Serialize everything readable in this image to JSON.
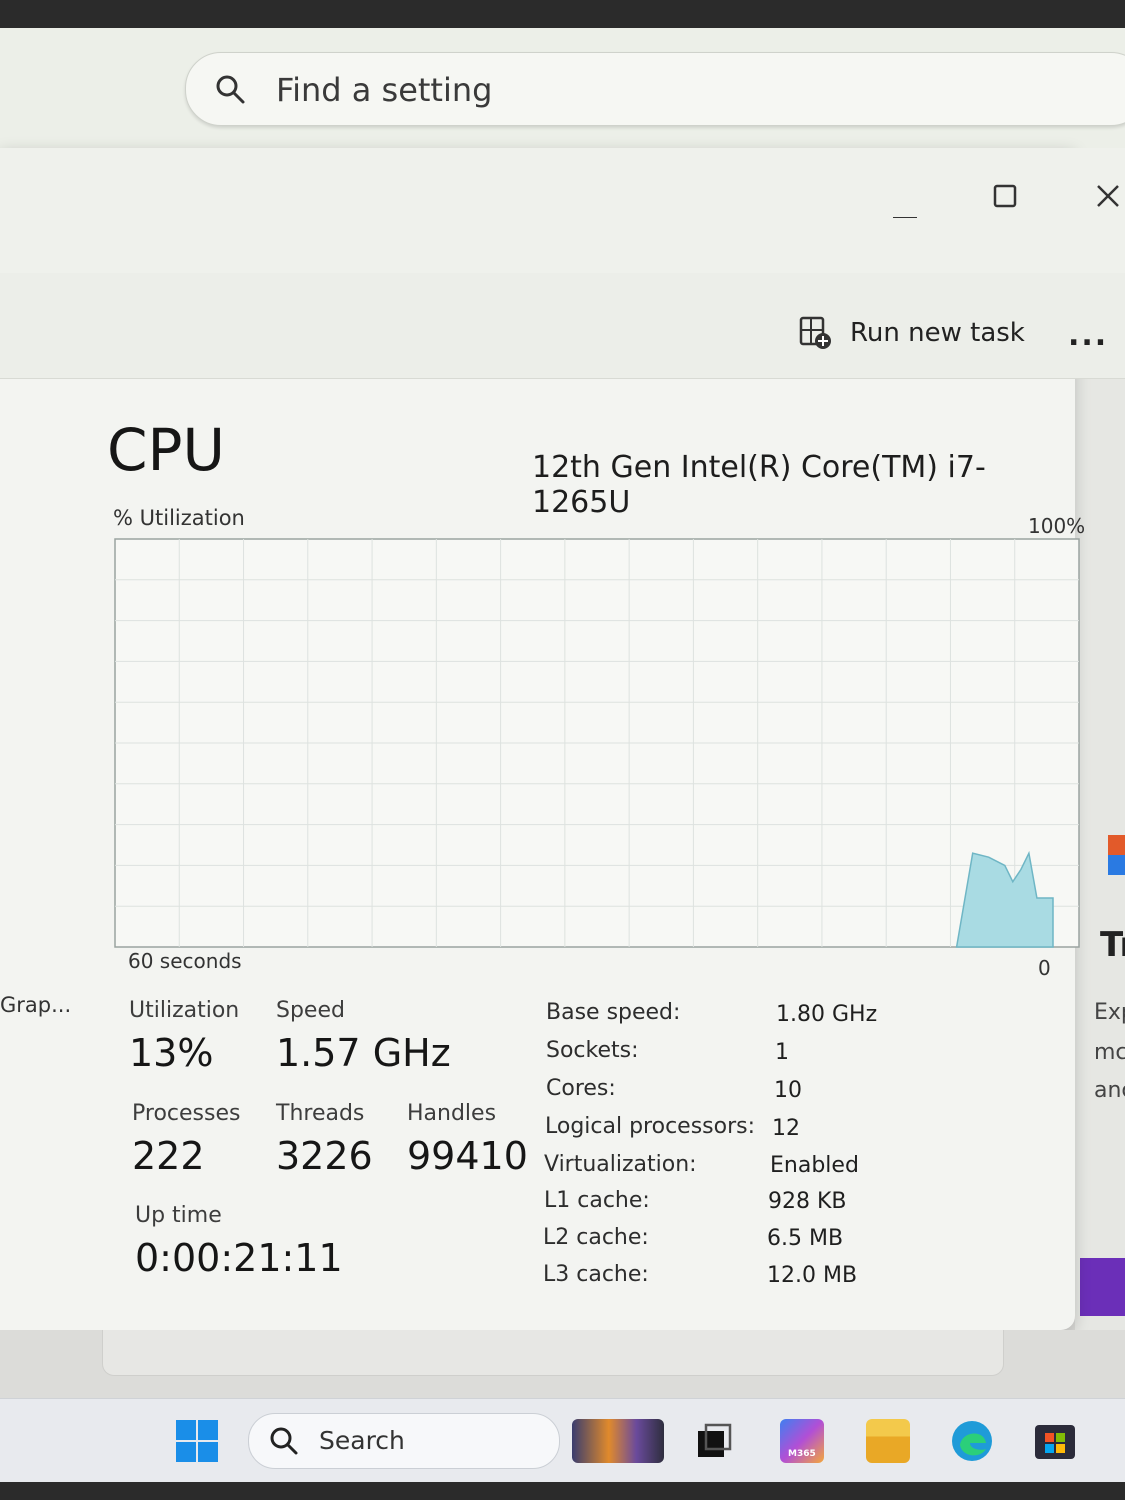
{
  "settings_search": {
    "placeholder": "Find a setting"
  },
  "window_controls": {
    "minimize": "minimize-icon",
    "maximize": "maximize-icon",
    "close": "close-icon"
  },
  "toolbar": {
    "run_new_task": "Run new task",
    "more": "..."
  },
  "sidebar": {
    "partial_item": "Grap..."
  },
  "cpu": {
    "title": "CPU",
    "model": "12th Gen Intel(R) Core(TM) i7-1265U",
    "graph": {
      "y_label": "% Utilization",
      "y_max_label": "100%",
      "x_label": "60 seconds",
      "y_min_label": "0",
      "color": "#a9dbe3",
      "line_color": "#6fb6c5"
    },
    "stats": {
      "utilization_label": "Utilization",
      "utilization": "13%",
      "speed_label": "Speed",
      "speed": "1.57 GHz",
      "processes_label": "Processes",
      "processes": "222",
      "threads_label": "Threads",
      "threads": "3226",
      "handles_label": "Handles",
      "handles": "99410",
      "uptime_label": "Up time",
      "uptime": "0:00:21:11"
    },
    "specs": [
      {
        "label": "Base speed:",
        "value": "1.80 GHz"
      },
      {
        "label": "Sockets:",
        "value": "1"
      },
      {
        "label": "Cores:",
        "value": "10"
      },
      {
        "label": "Logical processors:",
        "value": "12"
      },
      {
        "label": "Virtualization:",
        "value": "Enabled"
      },
      {
        "label": "L1 cache:",
        "value": "928 KB"
      },
      {
        "label": "L2 cache:",
        "value": "6.5 MB"
      },
      {
        "label": "L3 cache:",
        "value": "12.0 MB"
      }
    ]
  },
  "chart_data": {
    "type": "area",
    "xlabel": "60 seconds",
    "ylabel": "% Utilization",
    "ylim": [
      0,
      100
    ],
    "xlim": [
      60,
      0
    ],
    "x": [
      6,
      5,
      4,
      3,
      2.5,
      2,
      1.5,
      1,
      0
    ],
    "values": [
      0,
      23,
      22,
      20,
      16,
      19,
      23,
      12,
      12
    ],
    "grid": true
  },
  "background_peek": {
    "tr": "Tr",
    "exp1": "Exp",
    "exp2": "mc",
    "exp3": "anc"
  },
  "taskbar": {
    "search_label": "Search",
    "icons": [
      "windows-start-icon",
      "search-icon",
      "widgets-icon",
      "task-view-icon",
      "m365-copilot-icon",
      "file-explorer-icon",
      "edge-icon",
      "store-icon"
    ],
    "m365_text": "M365"
  }
}
